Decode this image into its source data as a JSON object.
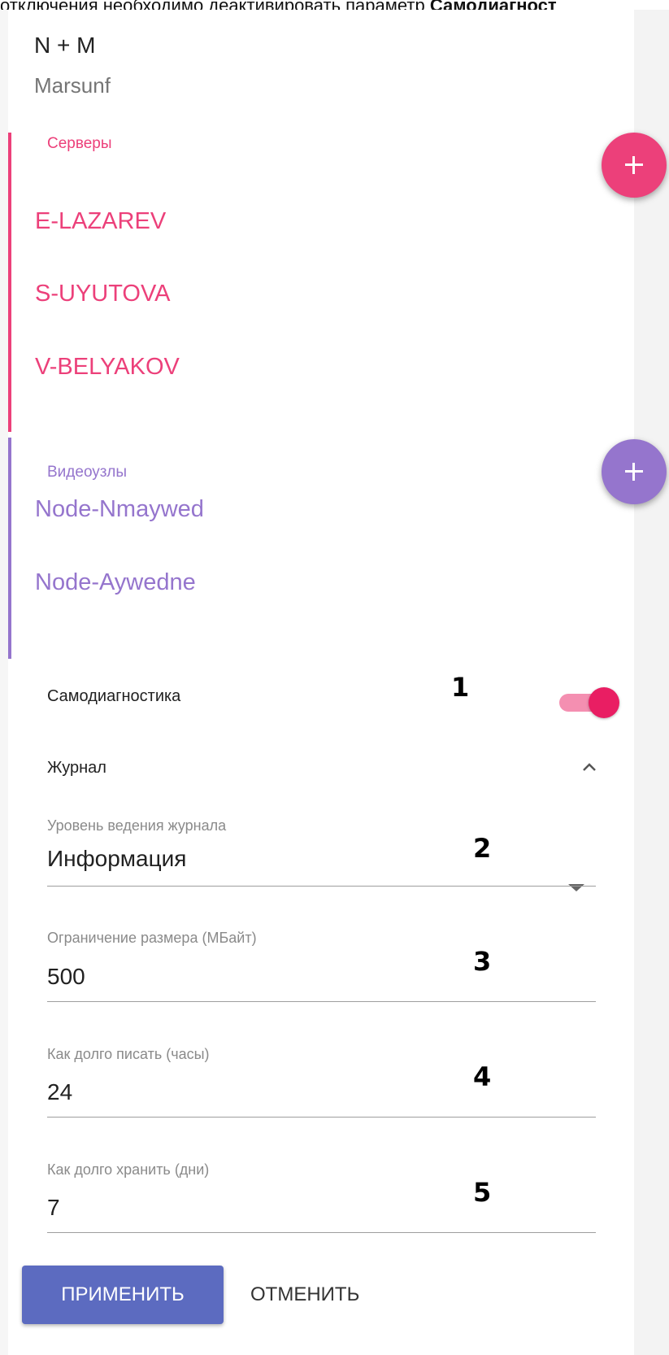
{
  "caption": {
    "prefix": "отключения необходимо деактивировать параметр ",
    "bold": "Самодиагност"
  },
  "header": {
    "title": "N + M",
    "subtitle": "Marsunf"
  },
  "servers": {
    "title": "Серверы",
    "color": "#ec407a",
    "items": [
      {
        "label": "E-LAZAREV"
      },
      {
        "label": "S-UYUTOVA"
      },
      {
        "label": "V-BELYAKOV"
      }
    ]
  },
  "nodes": {
    "title": "Видеоузлы",
    "color": "#9575cd",
    "items": [
      {
        "label": "Node-Nmaywed"
      },
      {
        "label": "Node-Aywedne"
      }
    ]
  },
  "self_diagnostics": {
    "label": "Самодиагностика",
    "enabled": true,
    "marker": "1"
  },
  "journal": {
    "label": "Журнал",
    "expanded": true,
    "fields": [
      {
        "label": "Уровень ведения журнала",
        "value": "Информация",
        "marker": "2",
        "type": "select"
      },
      {
        "label": "Ограничение размера (МБайт)",
        "value": "500",
        "marker": "3",
        "type": "text"
      },
      {
        "label": "Как долго писать (часы)",
        "value": "24",
        "marker": "4",
        "type": "text"
      },
      {
        "label": "Как долго хранить (дни)",
        "value": "7",
        "marker": "5",
        "type": "text"
      }
    ]
  },
  "actions": {
    "apply_label": "ПРИМЕНИТЬ",
    "cancel_label": "ОТМЕНИТЬ"
  },
  "colors": {
    "accent_primary": "#5c6bc0",
    "toggle_on": "#e91e63"
  }
}
